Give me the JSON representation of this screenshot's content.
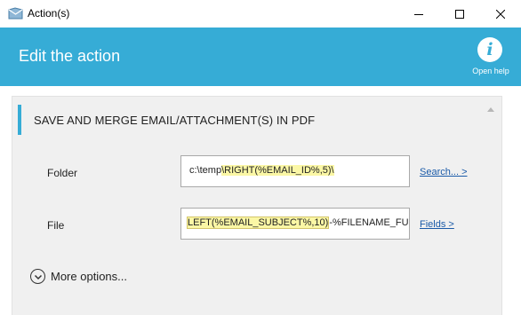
{
  "window": {
    "title": "Action(s)",
    "icon": "app-envelope-icon"
  },
  "header": {
    "title": "Edit the action",
    "help_label": "Open help",
    "help_icon": "help-i-icon",
    "background": "#36acd6"
  },
  "section": {
    "title": "SAVE AND MERGE EMAIL/ATTACHMENT(S) IN PDF",
    "accent_color": "#36acd6"
  },
  "folder": {
    "label": "Folder",
    "value_prefix": "c:\\temp",
    "value_highlight": "\\RIGHT(%EMAIL_ID%,5)\\",
    "link": "Search... >"
  },
  "file": {
    "label": "File",
    "value_highlight": "LEFT(%EMAIL_SUBJECT%,10)",
    "value_suffix": "-%FILENAME_FU",
    "link": "Fields >"
  },
  "more_options": {
    "label": "More options...",
    "icon": "chevron-down-circle-icon"
  },
  "highlight_color": "#fbf7a5"
}
